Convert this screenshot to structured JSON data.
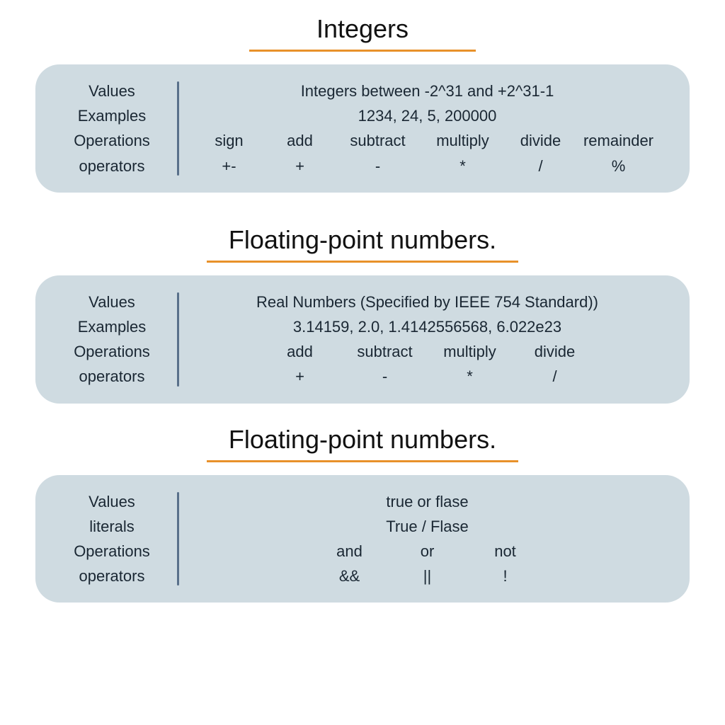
{
  "colors": {
    "card_bg": "#cfdbe1",
    "underline": "#e8912a",
    "divider": "#59708a",
    "text": "#1a2733"
  },
  "sections": [
    {
      "title": "Integers",
      "underline_width": 320,
      "labels": [
        "Values",
        "Examples",
        "Operations",
        "operators"
      ],
      "values_line": "Integers between -2^31 and +2^31-1",
      "examples_line": "1234, 24, 5, 200000",
      "ops": [
        {
          "name": "sign",
          "sym": "+-"
        },
        {
          "name": "add",
          "sym": "+"
        },
        {
          "name": "subtract",
          "sym": "-"
        },
        {
          "name": "multiply",
          "sym": "*"
        },
        {
          "name": "divide",
          "sym": "/"
        },
        {
          "name": "remainder",
          "sym": "%"
        }
      ]
    },
    {
      "title": "Floating-point numbers.",
      "underline_width": 440,
      "labels": [
        "Values",
        "Examples",
        "Operations",
        "operators"
      ],
      "values_line": "Real Numbers (Specified by IEEE 754 Standard))",
      "examples_line": "3.14159, 2.0, 1.4142556568, 6.022e23",
      "ops": [
        {
          "name": "add",
          "sym": "+"
        },
        {
          "name": "subtract",
          "sym": "-"
        },
        {
          "name": "multiply",
          "sym": "*"
        },
        {
          "name": "divide",
          "sym": "/"
        }
      ]
    },
    {
      "title": "Floating-point numbers.",
      "underline_width": 440,
      "labels": [
        "Values",
        "literals",
        "Operations",
        "operators"
      ],
      "values_line": "true or flase",
      "examples_line": "True / Flase",
      "ops": [
        {
          "name": "and",
          "sym": "&&"
        },
        {
          "name": "or",
          "sym": "||"
        },
        {
          "name": "not",
          "sym": "!"
        }
      ]
    }
  ]
}
